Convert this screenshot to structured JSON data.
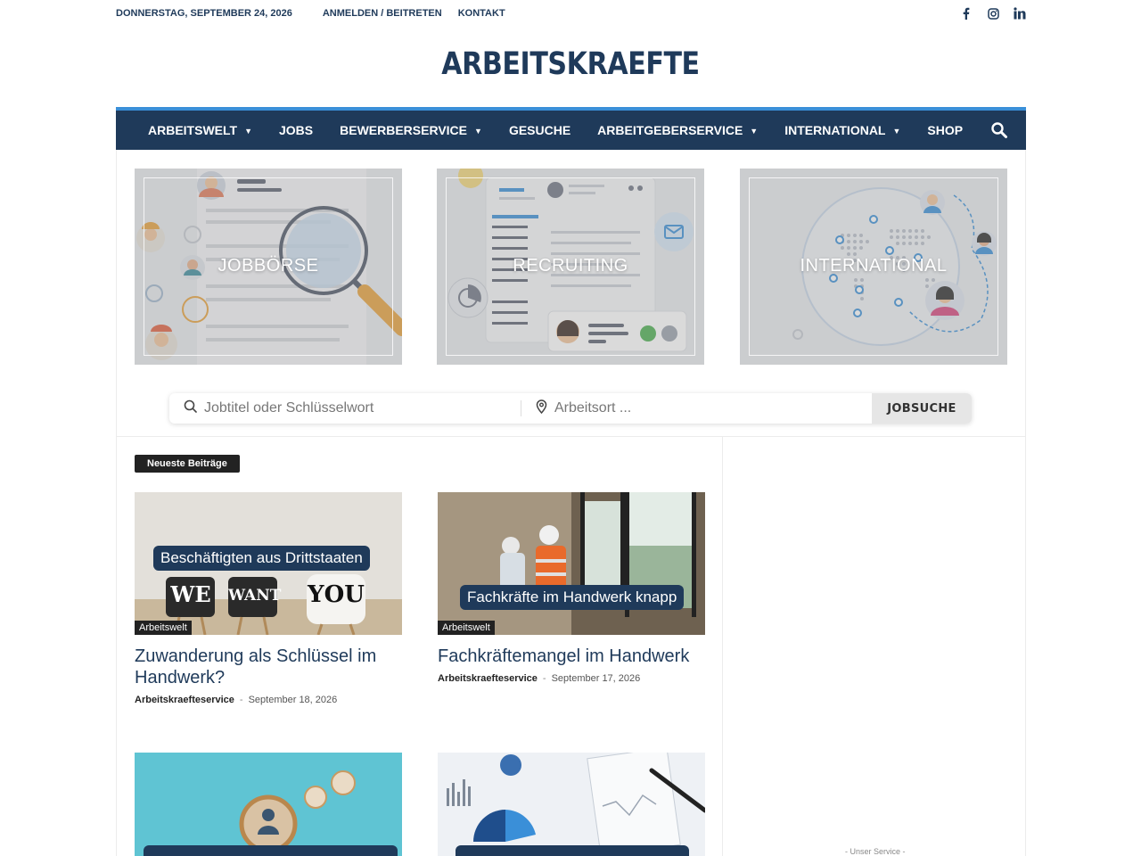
{
  "topbar": {
    "date": "DONNERSTAG, SEPTEMBER 24, 2026",
    "login": "ANMELDEN / BEITRETEN",
    "contact": "KONTAKT",
    "social": [
      "facebook-icon",
      "instagram-icon",
      "linkedin-icon"
    ]
  },
  "logo": "ARBEITSKRAEFTE",
  "nav": {
    "items": [
      {
        "label": "ARBEITSWELT",
        "dropdown": true
      },
      {
        "label": "JOBS",
        "dropdown": false
      },
      {
        "label": "BEWERBERSERVICE",
        "dropdown": true
      },
      {
        "label": "GESUCHE",
        "dropdown": false
      },
      {
        "label": "ARBEITGEBERSERVICE",
        "dropdown": true
      },
      {
        "label": "INTERNATIONAL",
        "dropdown": true
      },
      {
        "label": "SHOP",
        "dropdown": false
      }
    ]
  },
  "tiles": [
    {
      "label": "JOBBÖRSE"
    },
    {
      "label": "RECRUITING"
    },
    {
      "label": "INTERNATIONAL"
    }
  ],
  "jobsearch": {
    "keyword_placeholder": "Jobtitel oder Schlüsselwort",
    "location_placeholder": "Arbeitsort ...",
    "button": "JOBSUCHE"
  },
  "section": {
    "title": "Neueste Beiträge"
  },
  "posts": [
    {
      "image_banner": "Beschäftigten aus Drittstaaten",
      "image_words": [
        "WE",
        "WANT",
        "YOU"
      ],
      "category": "Arbeitswelt",
      "title": "Zuwanderung als Schlüssel im Handwerk?",
      "author": "Arbeitskraefteservice",
      "date": "September 18, 2026"
    },
    {
      "image_banner": "Fachkräfte im Handwerk knapp",
      "category": "Arbeitswelt",
      "title": "Fachkräftemangel im Handwerk",
      "author": "Arbeitskraefteservice",
      "date": "September 17, 2026"
    }
  ],
  "sidebar": {
    "note": "- Unser Service -"
  },
  "colors": {
    "brand": "#1f3a5a",
    "accent": "#3a8fd8"
  }
}
